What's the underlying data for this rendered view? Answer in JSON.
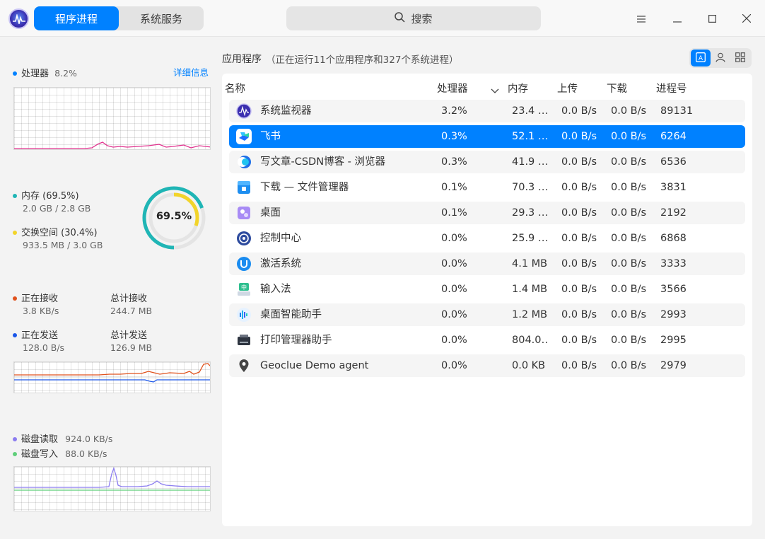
{
  "header": {
    "tabs": [
      {
        "label": "程序进程",
        "active": true
      },
      {
        "label": "系统服务",
        "active": false
      }
    ],
    "search_label": "搜索",
    "window_buttons": [
      "menu-icon",
      "minimize-icon",
      "maximize-icon",
      "close-icon"
    ]
  },
  "sidebar": {
    "cpu": {
      "label": "处理器",
      "value": "8.2%",
      "detail_link": "详细信息",
      "color": "#e0328e"
    },
    "memory": {
      "mem_label": "内存 (69.5%)",
      "mem_value": "2.0 GB / 2.8 GB",
      "mem_color": "#1fb5b5",
      "swap_label": "交换空间 (30.4%)",
      "swap_value": "933.5 MB / 3.0 GB",
      "swap_color": "#f2d42a",
      "ring_label": "69.5%",
      "mem_percent": 69.5,
      "swap_percent": 30.4
    },
    "network": {
      "recv_label": "正在接收",
      "recv_value": "3.8 KB/s",
      "recv_color": "#e0511c",
      "total_recv_label": "总计接收",
      "total_recv_value": "244.7 MB",
      "send_label": "正在发送",
      "send_value": "128.0 B/s",
      "send_color": "#1a56e8",
      "total_send_label": "总计发送",
      "total_send_value": "126.9 MB"
    },
    "disk": {
      "read_label": "磁盘读取",
      "read_value": "924.0 KB/s",
      "read_color": "#8b7cf0",
      "write_label": "磁盘写入",
      "write_value": "88.0 KB/s",
      "write_color": "#5fcf7a"
    }
  },
  "main": {
    "section_title": "应用程序",
    "section_summary": "（正在运行11个应用程序和327个系统进程）",
    "columns": [
      "名称",
      "处理器",
      "内存",
      "上传",
      "下载",
      "进程号"
    ],
    "rows": [
      {
        "name": "系统监视器",
        "cpu": "3.2%",
        "mem": "23.4 …",
        "up": "0.0 B/s",
        "down": "0.0 B/s",
        "pid": "89131",
        "icon": "system-monitor-icon"
      },
      {
        "name": "飞书",
        "cpu": "0.3%",
        "mem": "52.1 …",
        "up": "0.0 B/s",
        "down": "0.0 B/s",
        "pid": "6264",
        "icon": "feishu-icon"
      },
      {
        "name": "写文章-CSDN博客 - 浏览器",
        "cpu": "0.3%",
        "mem": "41.9 …",
        "up": "0.0 B/s",
        "down": "0.0 B/s",
        "pid": "6536",
        "icon": "browser-icon"
      },
      {
        "name": "下载 — 文件管理器",
        "cpu": "0.1%",
        "mem": "70.3 …",
        "up": "0.0 B/s",
        "down": "0.0 B/s",
        "pid": "3831",
        "icon": "file-manager-icon"
      },
      {
        "name": "桌面",
        "cpu": "0.1%",
        "mem": "29.3 …",
        "up": "0.0 B/s",
        "down": "0.0 B/s",
        "pid": "2192",
        "icon": "desktop-icon"
      },
      {
        "name": "控制中心",
        "cpu": "0.0%",
        "mem": "25.9 …",
        "up": "0.0 B/s",
        "down": "0.0 B/s",
        "pid": "6868",
        "icon": "control-center-icon"
      },
      {
        "name": "激活系统",
        "cpu": "0.0%",
        "mem": "4.1 MB",
        "up": "0.0 B/s",
        "down": "0.0 B/s",
        "pid": "3333",
        "icon": "activation-icon"
      },
      {
        "name": "输入法",
        "cpu": "0.0%",
        "mem": "1.4 MB",
        "up": "0.0 B/s",
        "down": "0.0 B/s",
        "pid": "3566",
        "icon": "input-method-icon"
      },
      {
        "name": "桌面智能助手",
        "cpu": "0.0%",
        "mem": "1.2 MB",
        "up": "0.0 B/s",
        "down": "0.0 B/s",
        "pid": "2993",
        "icon": "assistant-icon"
      },
      {
        "name": "打印管理器助手",
        "cpu": "0.0%",
        "mem": "804.0…",
        "up": "0.0 B/s",
        "down": "0.0 B/s",
        "pid": "2995",
        "icon": "printer-icon"
      },
      {
        "name": "Geoclue Demo agent",
        "cpu": "0.0%",
        "mem": "0.0 KB",
        "up": "0.0 B/s",
        "down": "0.0 B/s",
        "pid": "2979",
        "icon": "location-pin-icon"
      }
    ],
    "selected_row": 1,
    "sort_column": "处理器",
    "accent_color": "#0081ff"
  }
}
